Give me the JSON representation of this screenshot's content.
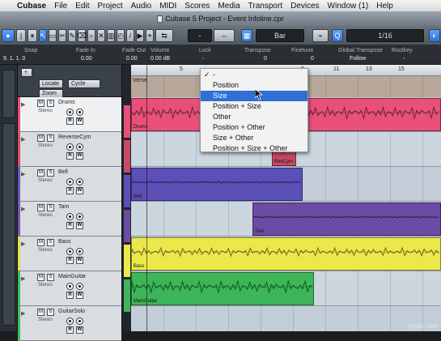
{
  "menubar": {
    "apple": "",
    "items": [
      "Cubase",
      "File",
      "Edit",
      "Project",
      "Audio",
      "MIDI",
      "Scores",
      "Media",
      "Transport",
      "Devices",
      "Window (1)",
      "Help"
    ]
  },
  "window": {
    "title": "Cubase 5 Project - Event Infoline.cpr"
  },
  "toolbar": {
    "quantize_label": "-",
    "grid_label": "Bar",
    "quantize_value": "1/16"
  },
  "infoline": {
    "labels": [
      "Snap",
      "Fade In",
      "Fade Out",
      "Volume",
      "Lock",
      "Transpose",
      "Finetune",
      "Global Transpose",
      "Rootkey"
    ],
    "values": [
      "9. 1. 1. 0",
      "0.00",
      "0.00",
      "0.00 dB",
      "-",
      "0",
      "0",
      "Follow",
      "-"
    ]
  },
  "tracklist": {
    "locate_label": "Locate",
    "cycle_label": "Cycle",
    "zoom_label": "Zoom"
  },
  "tracks": [
    {
      "name": "Drums",
      "sub": "Stereo",
      "color": "#e84f7a"
    },
    {
      "name": "ReverseCym",
      "sub": "Stereo",
      "color": "#d94f6f"
    },
    {
      "name": "Bell",
      "sub": "Stereo",
      "color": "#6a57c9"
    },
    {
      "name": "Tam",
      "sub": "Stereo",
      "color": "#7d57b8"
    },
    {
      "name": "Bass",
      "sub": "Stereo",
      "color": "#e6df4a"
    },
    {
      "name": "MainGuitar",
      "sub": "Stereo",
      "color": "#3fbf5f"
    },
    {
      "name": "GuitarSolo",
      "sub": "Stereo",
      "color": "#3fbf5f"
    }
  ],
  "ruler": {
    "marks": [
      "",
      "5",
      "",
      "9",
      "11",
      "13",
      "15"
    ]
  },
  "marker_row": {
    "label": "Verse"
  },
  "parts": [
    {
      "label": "Drums",
      "color": "#e8507a"
    },
    {
      "label": "RevCym",
      "color": "#c44a66"
    },
    {
      "label": "Bell",
      "color": "#5c4fb8"
    },
    {
      "label": "Tam",
      "color": "#6b4ba6"
    },
    {
      "label": "Bass",
      "color": "#ece84a"
    },
    {
      "label": "MainGuitar",
      "color": "#3cb658"
    }
  ],
  "dropdown": {
    "check": "✓",
    "options": [
      "-",
      "Position",
      "Size",
      "Position + Size",
      "Other",
      "Position + Other",
      "Size + Other",
      "Position + Size + Other"
    ],
    "selected": "Size"
  },
  "watermark": "lynda.com"
}
